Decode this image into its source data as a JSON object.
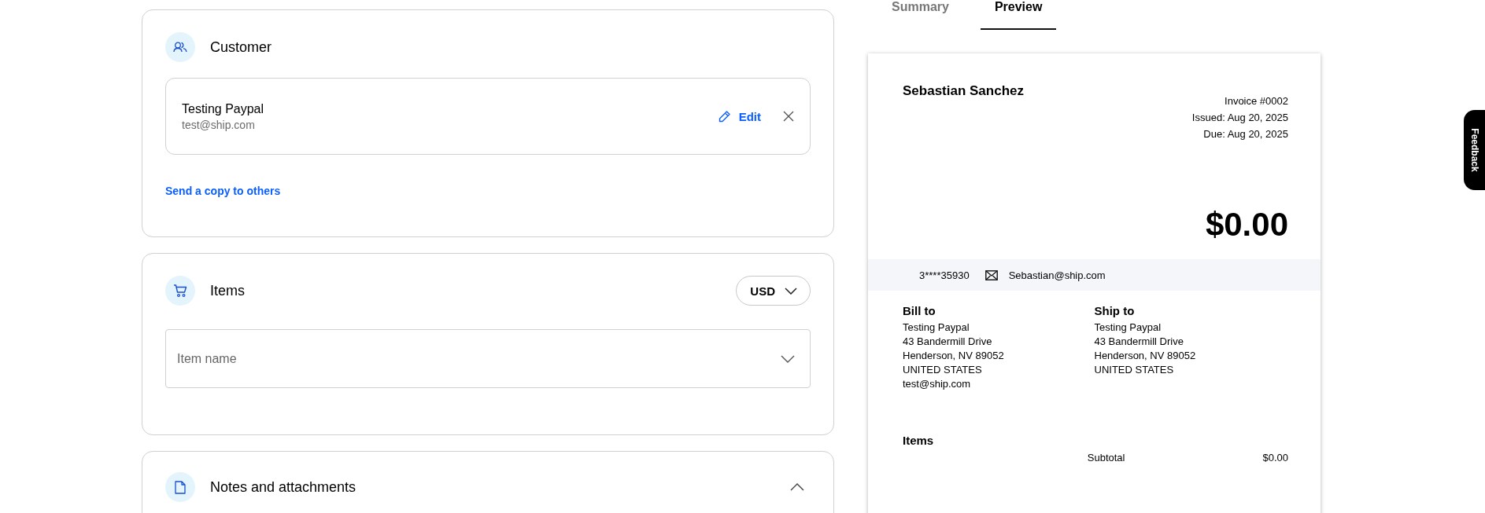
{
  "customer_card": {
    "title": "Customer",
    "customer": {
      "name": "Testing Paypal",
      "email": "test@ship.com"
    },
    "edit_label": "Edit",
    "send_copy_link": "Send a copy to others"
  },
  "items_card": {
    "title": "Items",
    "currency": "USD",
    "item_field": {
      "placeholder": "Item name"
    }
  },
  "notes_card": {
    "title": "Notes and attachments",
    "expanded": true
  },
  "tabs": [
    {
      "label": "Summary",
      "selected": false
    },
    {
      "label": "Preview",
      "selected": true
    }
  ],
  "invoice": {
    "sender": "Sebastian Sanchez",
    "meta": [
      "Invoice #0002",
      "Issued: Aug 20, 2025",
      "Due: Aug 20, 2025"
    ],
    "amount": "$0.00",
    "phone": "3****35930",
    "email": "Sebastian@ship.com",
    "addresses": [
      {
        "heading": "Bill to",
        "lines": [
          "Testing Paypal",
          "43 Bandermill Drive",
          "Henderson, NV 89052",
          "UNITED STATES",
          "test@ship.com"
        ]
      },
      {
        "heading": "Ship to",
        "lines": [
          "Testing Paypal",
          "43 Bandermill Drive",
          "Henderson, NV 89052",
          "UNITED STATES"
        ]
      }
    ],
    "items_heading": "Items",
    "subtotal_label": "Subtotal",
    "subtotal_value": "$0.00"
  },
  "feedback_tab": "Feedback"
}
